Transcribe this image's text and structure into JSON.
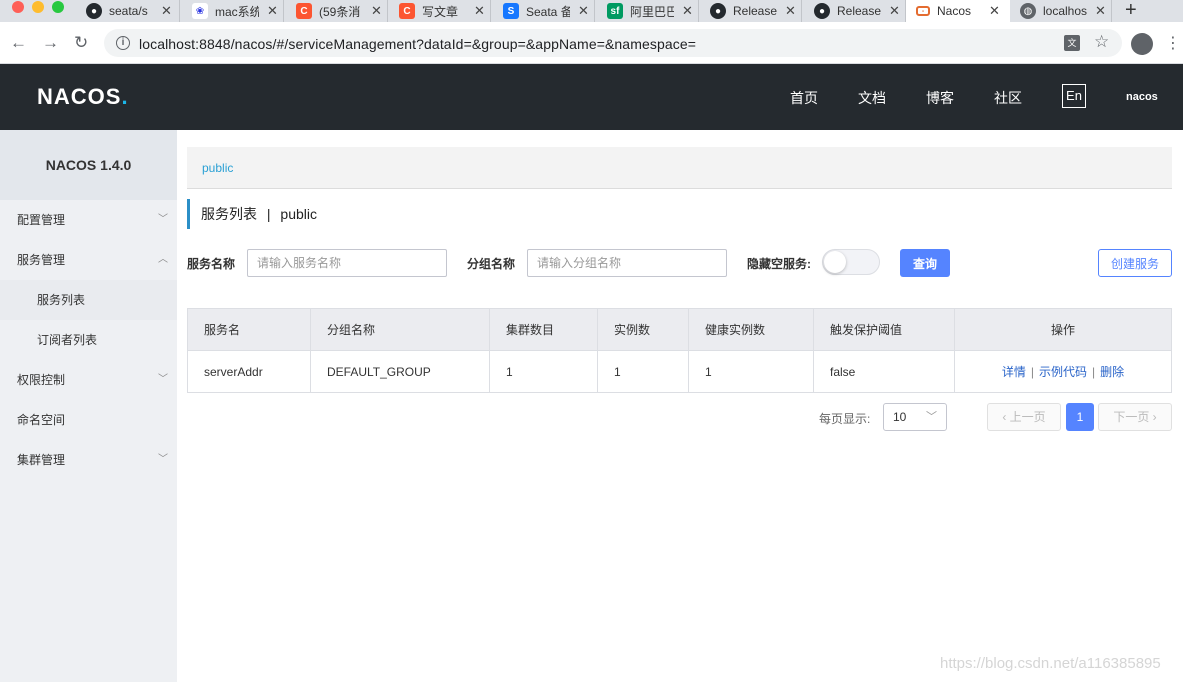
{
  "browser": {
    "tabs": [
      {
        "label": "seata/s",
        "icon": "github-icon",
        "color": "#24292e"
      },
      {
        "label": "mac系统",
        "icon": "baidu-paw-icon",
        "color": "#2932e1"
      },
      {
        "label": "(59条消",
        "icon": "csdn-c-icon",
        "color": "#fc5531"
      },
      {
        "label": "写文章",
        "icon": "csdn-c-icon",
        "color": "#fc5531"
      },
      {
        "label": "Seata 备",
        "icon": "seata-s-icon",
        "color": "#1677ff"
      },
      {
        "label": "阿里巴巴",
        "icon": "segmentfault-icon",
        "color": "#009a61"
      },
      {
        "label": "Release",
        "icon": "github-icon",
        "color": "#24292e"
      },
      {
        "label": "Release",
        "icon": "github-icon",
        "color": "#24292e"
      },
      {
        "label": "Nacos",
        "icon": "nacos-icon",
        "color": "#e46c30"
      },
      {
        "label": "localhost",
        "icon": "globe-icon",
        "color": "#5f6368"
      }
    ],
    "url": "localhost:8848/nacos/#/serviceManagement?dataId=&group=&appName=&namespace="
  },
  "header": {
    "logo": "NACOS",
    "logo_dot": ".",
    "nav": [
      "首页",
      "文档",
      "博客",
      "社区"
    ],
    "lang": "En",
    "user": "nacos"
  },
  "sidebar": {
    "title": "NACOS 1.4.0",
    "items": [
      {
        "label": "配置管理",
        "arrow": "﹀"
      },
      {
        "label": "服务管理",
        "arrow": "︿"
      },
      {
        "label": "服务列表"
      },
      {
        "label": "订阅者列表"
      },
      {
        "label": "权限控制",
        "arrow": "﹀"
      },
      {
        "label": "命名空间"
      },
      {
        "label": "集群管理",
        "arrow": "﹀"
      }
    ]
  },
  "main": {
    "breadcrumb": "public",
    "title": "服务列表",
    "title_sep": "|",
    "namespace": "public",
    "filters": {
      "service_label": "服务名称",
      "service_placeholder": "请输入服务名称",
      "group_label": "分组名称",
      "group_placeholder": "请输入分组名称",
      "hide_empty_label": "隐藏空服务:",
      "hide_empty_on": false,
      "query_button": "查询",
      "create_button": "创建服务"
    },
    "table": {
      "columns": [
        "服务名",
        "分组名称",
        "集群数目",
        "实例数",
        "健康实例数",
        "触发保护阈值",
        "操作"
      ],
      "rows": [
        {
          "name": "serverAddr",
          "group": "DEFAULT_GROUP",
          "clusters": "1",
          "instances": "1",
          "healthy": "1",
          "threshold": "false"
        }
      ],
      "actions": [
        "详情",
        "示例代码",
        "删除"
      ],
      "action_sep": "|"
    },
    "pagination": {
      "page_size_label": "每页显示:",
      "page_size": "10",
      "prev": "上一页",
      "next": "下一页",
      "current": "1"
    }
  },
  "watermark": "https://blog.csdn.net/a116385895",
  "colors": {
    "accent": "#5584ff",
    "header_bg": "#252a2f",
    "link": "#2aa0d4"
  }
}
